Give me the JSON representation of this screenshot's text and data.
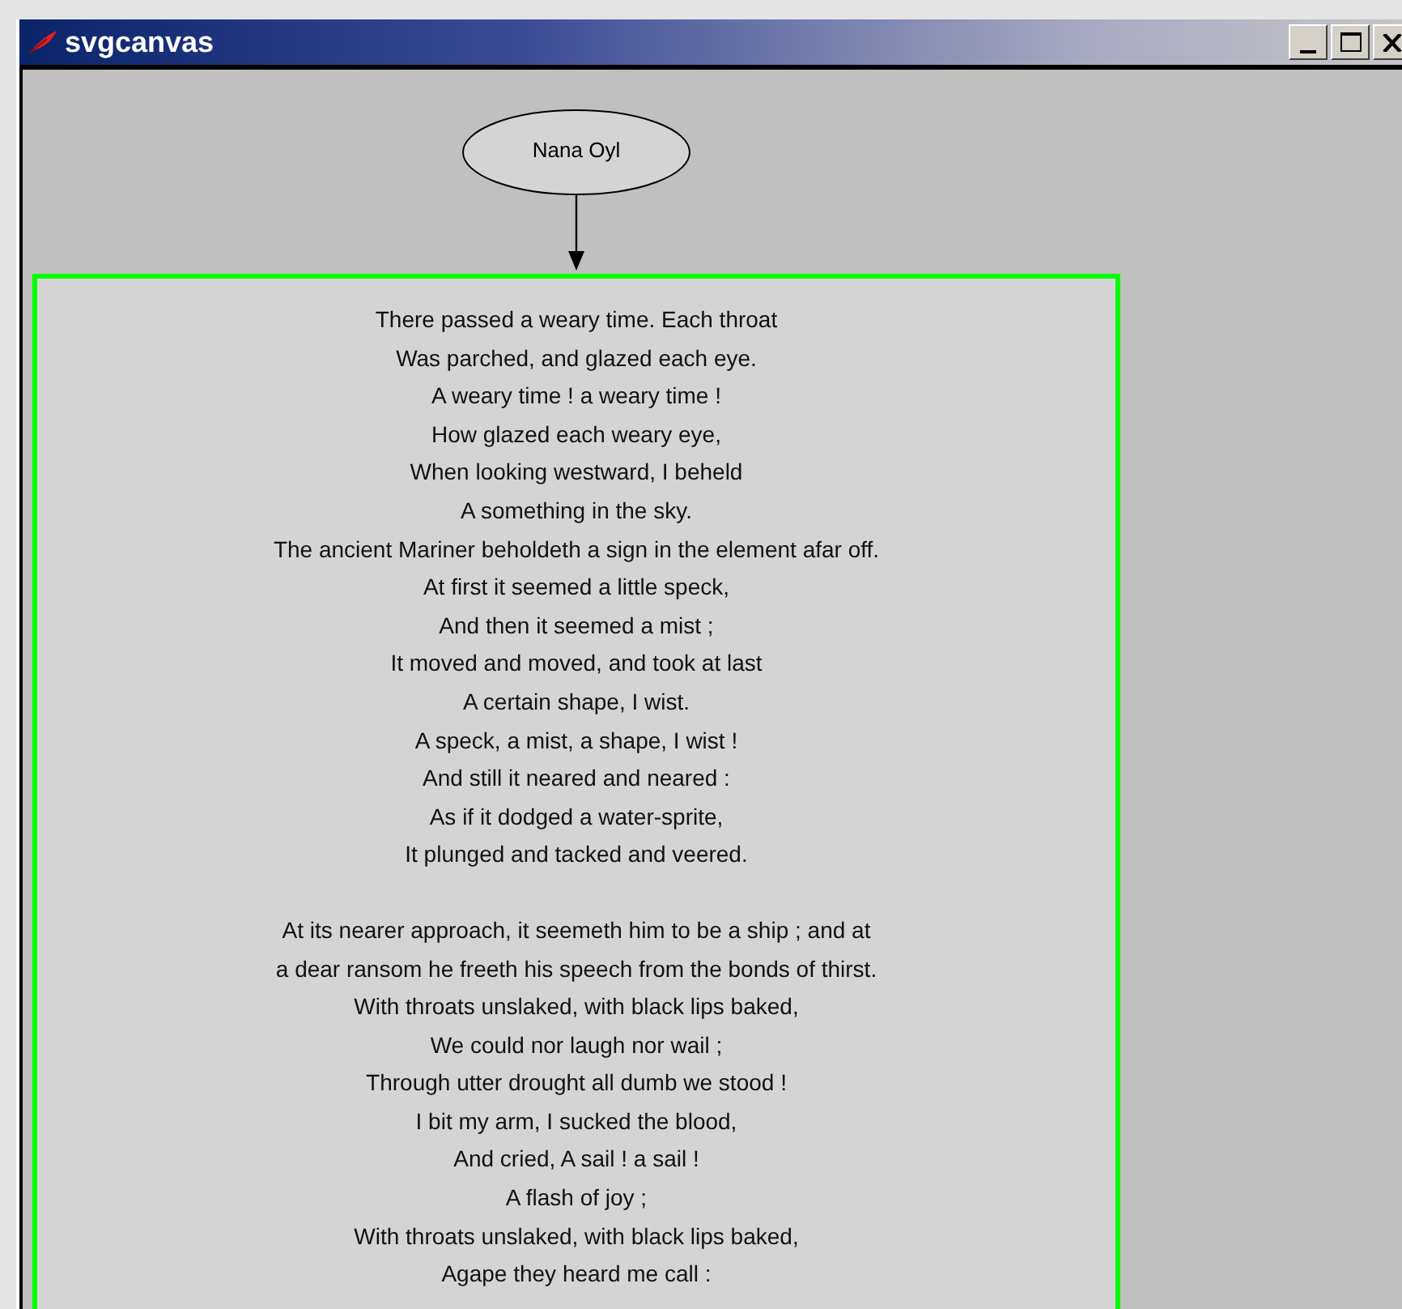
{
  "window": {
    "title": "svgcanvas"
  },
  "node": {
    "label": "Nana Oyl"
  },
  "stanzas": [
    {
      "lines": [
        "There passed a weary time. Each throat",
        "Was parched, and glazed each eye.",
        "A weary time ! a weary time !",
        "How glazed each weary eye,",
        "When looking westward, I beheld",
        "A something in the sky.",
        "The ancient Mariner beholdeth a sign in the element afar off.",
        "At first it seemed a little speck,",
        "And then it seemed a mist ;",
        "It moved and moved, and took at last",
        "A certain shape, I wist.",
        "A speck, a mist, a shape, I wist !",
        "And still it neared and neared :",
        "As if it dodged a water-sprite,",
        "It plunged and tacked and veered."
      ]
    },
    {
      "lines": [
        "At its nearer approach, it seemeth him to be a ship ; and at",
        "a dear ransom he freeth his speech from the bonds of thirst.",
        "With throats unslaked, with black lips baked,",
        "We could nor laugh nor wail ;",
        "Through utter drought all dumb we stood !",
        "I bit my arm, I sucked the blood,",
        "And cried, A sail ! a sail !",
        "A flash of joy ;",
        "With throats unslaked, with black lips baked,",
        "Agape they heard me call :"
      ]
    }
  ]
}
